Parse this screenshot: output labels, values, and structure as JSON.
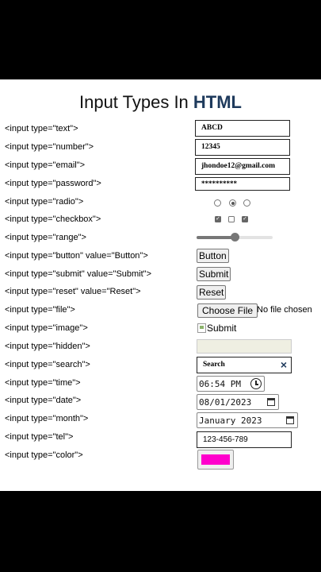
{
  "title_plain": "Input Types In ",
  "title_bold": "HTML",
  "rows": [
    {
      "label": "<input type=\"text\">"
    },
    {
      "label": "<input type=\"number\">"
    },
    {
      "label": "<input type=\"email\">"
    },
    {
      "label": "<input type=\"password\">"
    },
    {
      "label": "<input type=\"radio\">"
    },
    {
      "label": "<input type=\"checkbox\">"
    },
    {
      "label": "<input type=\"range\">"
    },
    {
      "label": "<input type=\"button\" value=\"Button\">"
    },
    {
      "label": "<input type=\"submit\" value=\"Submit\">"
    },
    {
      "label": "<input type=\"reset\" value=\"Reset\">"
    },
    {
      "label": "<input type=\"file\">"
    },
    {
      "label": "<input type=\"image\">"
    },
    {
      "label": "<input type=\"hidden\">"
    },
    {
      "label": "<input type=\"search\">"
    },
    {
      "label": "<input type=\"time\">"
    },
    {
      "label": "<input type=\"date\">"
    },
    {
      "label": "<input type=\"month\">"
    },
    {
      "label": "<input type=\"tel\">"
    },
    {
      "label": "<input type=\"color\">"
    }
  ],
  "controls": {
    "text_value": "ABCD",
    "number_value": "12345",
    "email_value": "jhondoe12@gmail.com",
    "password_value": "**********",
    "range_value_fraction": 0.5,
    "button_label": "Button",
    "submit_label": "Submit",
    "reset_label": "Reset",
    "file_button": "Choose File",
    "file_status": "No file chosen",
    "image_alt": "Submit",
    "search_value": "Search",
    "search_clear": "×",
    "time_value": "06:54 PM",
    "date_value": "08/01/2023",
    "month_value": "January 2023",
    "tel_value": "123-456-789",
    "color_value": "#ff00cc"
  }
}
